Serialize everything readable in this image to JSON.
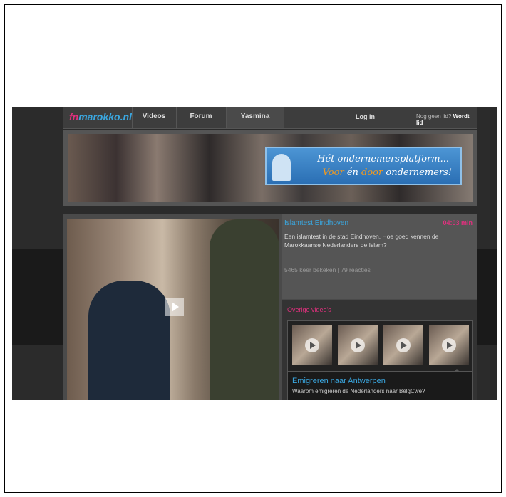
{
  "nav": {
    "logo_prefix": "fn",
    "logo_main": "marokko.nl",
    "items": [
      {
        "label": "Videos"
      },
      {
        "label": "Forum"
      },
      {
        "label": "Yasmina"
      }
    ],
    "login": "Log in",
    "signup_prompt": "Nog geen lid?",
    "signup_link": "Wordt lid"
  },
  "banner": {
    "line1": "Hét ondernemersplatform...",
    "line2_a": "Voor",
    "line2_b": "én",
    "line2_c": "door",
    "line2_d": "ondernemers!"
  },
  "video": {
    "title": "Islamtest Eindhoven",
    "badge": "04:03 min",
    "description": "Een islamtest in de stad Eindhoven. Hoe goed kennen de Marokkaanse Nederlanders de Islam?",
    "meta": "5465 keer bekeken | 79 reacties"
  },
  "other_videos": {
    "title": "Overige video's",
    "featured_title": "Emigreren naar Antwerpen",
    "featured_sub": "Waarom emigreren de Nederlanders naar BelgCwe?"
  },
  "colors": {
    "accent_blue": "#3aa7e0",
    "accent_pink": "#e0307e"
  }
}
